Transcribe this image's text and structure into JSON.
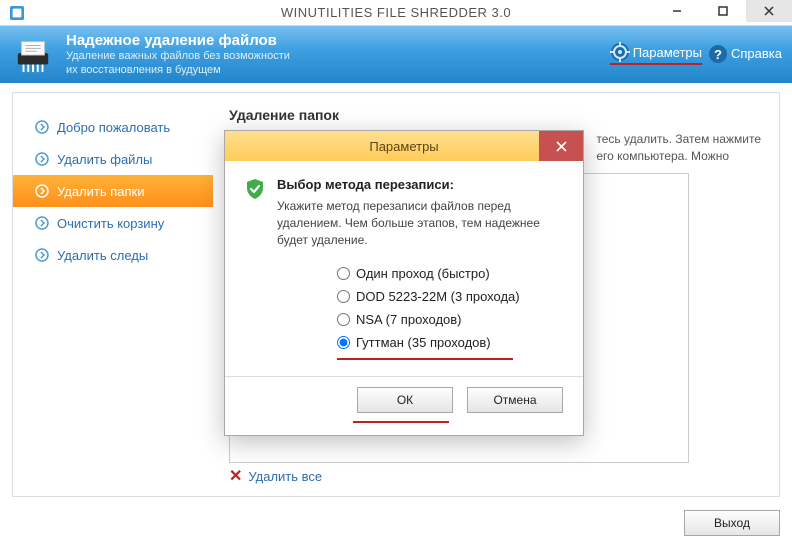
{
  "window": {
    "title": "WINUTILITIES FILE SHREDDER 3.0"
  },
  "header": {
    "title": "Надежное удаление файлов",
    "subtitle1": "Удаление важных файлов без возможности",
    "subtitle2": "их восстановления в будущем",
    "params_link": "Параметры",
    "help_link": "Справка"
  },
  "sidebar": {
    "items": [
      {
        "label": "Добро пожаловать"
      },
      {
        "label": "Удалить файлы"
      },
      {
        "label": "Удалить папки"
      },
      {
        "label": "Очистить корзину"
      },
      {
        "label": "Удалить следы"
      }
    ]
  },
  "main": {
    "section_title": "Удаление папок",
    "hint_tail": "тесь удалить. Затем нажмите",
    "hint_tail2": "его компьютера. Можно",
    "delete_all": "Удалить все"
  },
  "footer": {
    "exit": "Выход"
  },
  "modal": {
    "title": "Параметры",
    "heading": "Выбор метода перезаписи:",
    "desc": "Укажите метод перезаписи файлов перед удалением. Чем больше этапов, тем надежнее будет удаление.",
    "options": [
      "Один проход (быстро)",
      "DOD 5223-22M (3 прохода)",
      "NSA (7 проходов)",
      "Гуттман (35 проходов)"
    ],
    "ok": "ОК",
    "cancel": "Отмена"
  }
}
